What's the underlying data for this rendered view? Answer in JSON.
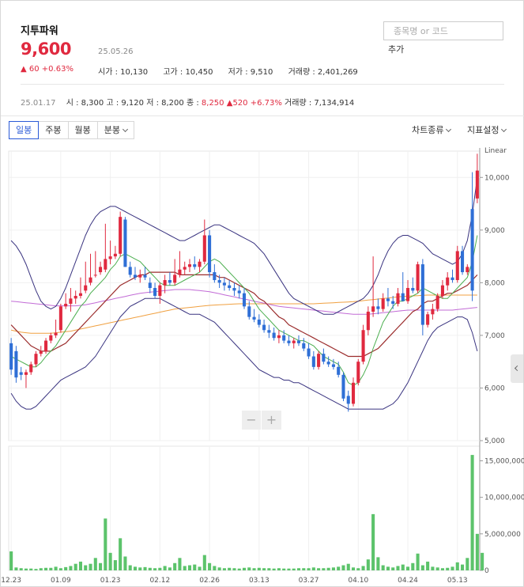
{
  "stock": {
    "name": "지투파워",
    "price": "9,600",
    "date": "25.05.26",
    "change": "60 +0.63%",
    "open": "시가 : 10,130",
    "high": "고가 : 10,450",
    "low": "저가 : 9,510",
    "volume": "거래량 : 2,401,269"
  },
  "search": {
    "placeholder": "종목명 or 코드",
    "add_label": "추가"
  },
  "base_info": {
    "date": "25.01.17",
    "open": "시 : 8,300",
    "high": "고 : 9,120",
    "low": "저 : 8,200",
    "close_label": "종 : ",
    "close_value": "8,250",
    "change": "520 +6.73%",
    "volume": "거래량 : 7,134,914"
  },
  "toolbar": {
    "tabs": [
      "일봉",
      "주봉",
      "월봉",
      "분봉"
    ],
    "chart_type": "차트종류",
    "indicator": "지표설정"
  },
  "zoom": {
    "minus": "−",
    "plus": "+"
  },
  "colors": {
    "up": "#e0293f",
    "down": "#2f6fd6",
    "volume": "#5cc36b",
    "bollinger": "#3a3480",
    "ma5": "#4caf50",
    "ma20": "#9b2c2c",
    "ma60": "#c26bd6",
    "ma120": "#f0a040"
  },
  "chart_data": [
    {
      "type": "candlestick",
      "scale_label": "Linear",
      "ylim": [
        5000,
        10500
      ],
      "yticks": [
        5000,
        6000,
        7000,
        8000,
        9000,
        10000
      ],
      "ytick_labels": [
        "5,000",
        "6,000",
        "7,000",
        "8,000",
        "9,000",
        "10,000"
      ],
      "x_labels": [
        "12.23",
        "01.09",
        "01.23",
        "02.12",
        "02.26",
        "03.13",
        "03.27",
        "04.10",
        "04.24",
        "05.13"
      ],
      "x_label_index": [
        0,
        10,
        20,
        30,
        40,
        50,
        60,
        70,
        80,
        90
      ],
      "ohlc": [
        [
          6850,
          6950,
          6250,
          6350
        ],
        [
          6700,
          6800,
          6100,
          6200
        ],
        [
          6300,
          6400,
          6150,
          6250
        ],
        [
          6250,
          6350,
          6000,
          6300
        ],
        [
          6300,
          6500,
          6250,
          6450
        ],
        [
          6450,
          6700,
          6400,
          6650
        ],
        [
          6650,
          6800,
          6600,
          6700
        ],
        [
          6700,
          6950,
          6650,
          6900
        ],
        [
          6900,
          7050,
          6850,
          7000
        ],
        [
          7000,
          7300,
          6950,
          7050
        ],
        [
          7100,
          7600,
          7050,
          7550
        ],
        [
          7550,
          7800,
          7500,
          7600
        ],
        [
          7600,
          7900,
          7450,
          7700
        ],
        [
          7700,
          7850,
          7600,
          7750
        ],
        [
          7750,
          8100,
          7700,
          7800
        ],
        [
          7850,
          8400,
          7800,
          7950
        ],
        [
          8000,
          8550,
          7950,
          8100
        ],
        [
          8150,
          8600,
          8100,
          8150
        ],
        [
          8200,
          8400,
          8150,
          8300
        ],
        [
          8250,
          9120,
          8200,
          8450
        ],
        [
          8450,
          8800,
          8350,
          8500
        ],
        [
          8500,
          8700,
          8450,
          8550
        ],
        [
          8550,
          9350,
          8500,
          9250
        ],
        [
          9200,
          9250,
          8300,
          8300
        ],
        [
          8300,
          8400,
          8100,
          8150
        ],
        [
          8150,
          8300,
          8050,
          8100
        ],
        [
          8100,
          8250,
          8000,
          8150
        ],
        [
          8150,
          8300,
          8050,
          8100
        ],
        [
          8000,
          8100,
          7800,
          7900
        ],
        [
          7900,
          8000,
          7700,
          7750
        ],
        [
          7750,
          8000,
          7600,
          7950
        ],
        [
          7950,
          8150,
          7800,
          8050
        ],
        [
          8050,
          8200,
          7950,
          8000
        ],
        [
          8000,
          8450,
          7950,
          8150
        ],
        [
          8150,
          8600,
          8100,
          8250
        ],
        [
          8250,
          8400,
          8150,
          8300
        ],
        [
          8300,
          8450,
          8200,
          8350
        ],
        [
          8350,
          8500,
          8250,
          8300
        ],
        [
          8300,
          8450,
          8200,
          8400
        ],
        [
          8400,
          9200,
          8350,
          8900
        ],
        [
          8900,
          9000,
          8100,
          8200
        ],
        [
          8200,
          8350,
          8000,
          8050
        ],
        [
          8050,
          8150,
          7900,
          8000
        ],
        [
          8000,
          8100,
          7850,
          7950
        ],
        [
          7950,
          8050,
          7850,
          7900
        ],
        [
          7900,
          8000,
          7750,
          7850
        ],
        [
          7850,
          7950,
          7700,
          7800
        ],
        [
          7800,
          7900,
          7500,
          7550
        ],
        [
          7550,
          7650,
          7300,
          7350
        ],
        [
          7350,
          7500,
          7250,
          7300
        ],
        [
          7300,
          7400,
          7150,
          7200
        ],
        [
          7200,
          7300,
          7050,
          7100
        ],
        [
          7100,
          7200,
          6950,
          7050
        ],
        [
          7050,
          7150,
          6900,
          6950
        ],
        [
          6950,
          7100,
          6850,
          7000
        ],
        [
          7000,
          7100,
          6850,
          6900
        ],
        [
          6900,
          7000,
          6800,
          6850
        ],
        [
          6850,
          6950,
          6750,
          6900
        ],
        [
          6900,
          7000,
          6800,
          6850
        ],
        [
          6850,
          6950,
          6700,
          6750
        ],
        [
          6750,
          6850,
          6550,
          6600
        ],
        [
          6600,
          6700,
          6350,
          6400
        ],
        [
          6400,
          6700,
          6350,
          6650
        ],
        [
          6650,
          6750,
          6450,
          6500
        ],
        [
          6500,
          6600,
          6400,
          6450
        ],
        [
          6450,
          6550,
          6350,
          6400
        ],
        [
          6400,
          6500,
          6200,
          6250
        ],
        [
          6250,
          6300,
          5750,
          5800
        ],
        [
          5850,
          5950,
          5550,
          5700
        ],
        [
          5700,
          6200,
          5650,
          6100
        ],
        [
          6100,
          6550,
          6050,
          6500
        ],
        [
          6500,
          7200,
          6450,
          7100
        ],
        [
          7100,
          7550,
          7000,
          7450
        ],
        [
          7450,
          8500,
          7350,
          7550
        ],
        [
          7550,
          7700,
          7400,
          7500
        ],
        [
          7500,
          7800,
          7450,
          7700
        ],
        [
          7700,
          7900,
          7550,
          7650
        ],
        [
          7650,
          7750,
          7500,
          7600
        ],
        [
          7600,
          7900,
          7550,
          7800
        ],
        [
          7800,
          8200,
          7700,
          7650
        ],
        [
          7650,
          8050,
          7600,
          7900
        ],
        [
          7900,
          8100,
          7800,
          7850
        ],
        [
          7850,
          8400,
          7800,
          8350
        ],
        [
          8350,
          8450,
          7000,
          7200
        ],
        [
          7200,
          7450,
          7150,
          7400
        ],
        [
          7400,
          7600,
          7300,
          7500
        ],
        [
          7500,
          7800,
          7450,
          7750
        ],
        [
          7750,
          8050,
          7700,
          7950
        ],
        [
          7950,
          8200,
          7850,
          8100
        ],
        [
          8100,
          8250,
          8000,
          8050
        ],
        [
          8050,
          8700,
          8000,
          8600
        ],
        [
          8600,
          8700,
          8150,
          8200
        ],
        [
          8200,
          8350,
          8150,
          8300
        ],
        [
          9400,
          10100,
          7650,
          7850
        ],
        [
          9600,
          10450,
          9510,
          10130
        ]
      ],
      "ma5": [
        6600,
        6550,
        6500,
        6450,
        6400,
        6400,
        6480,
        6600,
        6700,
        6800,
        6950,
        7100,
        7250,
        7400,
        7550,
        7650,
        7800,
        7900,
        8000,
        8100,
        8250,
        8350,
        8500,
        8550,
        8500,
        8450,
        8400,
        8300,
        8200,
        8100,
        8000,
        7950,
        7950,
        7950,
        8000,
        8050,
        8100,
        8150,
        8200,
        8300,
        8400,
        8450,
        8400,
        8300,
        8200,
        8100,
        8000,
        7900,
        7800,
        7650,
        7500,
        7400,
        7300,
        7200,
        7100,
        7050,
        7000,
        6950,
        6900,
        6900,
        6850,
        6800,
        6700,
        6600,
        6550,
        6500,
        6450,
        6300,
        6100,
        6050,
        6100,
        6250,
        6450,
        6750,
        7000,
        7250,
        7400,
        7550,
        7650,
        7650,
        7700,
        7750,
        7800,
        7900,
        7850,
        7800,
        7750,
        7700,
        7700,
        7800,
        7900,
        8000,
        8100,
        8400,
        8900
      ],
      "ma20": [
        7200,
        7100,
        7000,
        6900,
        6800,
        6750,
        6700,
        6700,
        6700,
        6750,
        6800,
        6850,
        6950,
        7050,
        7150,
        7250,
        7350,
        7450,
        7550,
        7650,
        7750,
        7850,
        7950,
        8000,
        8050,
        8100,
        8150,
        8150,
        8200,
        8200,
        8200,
        8200,
        8200,
        8200,
        8150,
        8150,
        8150,
        8150,
        8150,
        8150,
        8150,
        8150,
        8100,
        8100,
        8050,
        8000,
        7950,
        7900,
        7850,
        7800,
        7700,
        7650,
        7550,
        7450,
        7350,
        7300,
        7200,
        7150,
        7100,
        7050,
        7000,
        6950,
        6900,
        6850,
        6800,
        6750,
        6700,
        6650,
        6600,
        6600,
        6600,
        6600,
        6650,
        6700,
        6750,
        6850,
        6950,
        7050,
        7150,
        7250,
        7350,
        7450,
        7500,
        7600,
        7650,
        7650,
        7700,
        7750,
        7800,
        7800,
        7850,
        7900,
        7950,
        8050,
        8150
      ],
      "ma60": [
        7650,
        7640,
        7630,
        7620,
        7610,
        7600,
        7590,
        7580,
        7570,
        7560,
        7560,
        7560,
        7560,
        7560,
        7570,
        7580,
        7600,
        7620,
        7640,
        7660,
        7680,
        7700,
        7720,
        7740,
        7760,
        7780,
        7800,
        7810,
        7820,
        7830,
        7840,
        7850,
        7860,
        7870,
        7870,
        7870,
        7870,
        7860,
        7850,
        7840,
        7830,
        7810,
        7790,
        7770,
        7750,
        7730,
        7710,
        7690,
        7670,
        7650,
        7630,
        7610,
        7590,
        7570,
        7550,
        7540,
        7530,
        7520,
        7510,
        7500,
        7490,
        7480,
        7470,
        7460,
        7450,
        7440,
        7430,
        7420,
        7410,
        7400,
        7400,
        7400,
        7400,
        7410,
        7420,
        7430,
        7440,
        7450,
        7460,
        7470,
        7480,
        7480,
        7480,
        7480,
        7480,
        7480,
        7480,
        7480,
        7480,
        7480,
        7490,
        7500,
        7510,
        7520,
        7530
      ],
      "ma120": [
        7100,
        7080,
        7060,
        7050,
        7040,
        7040,
        7040,
        7040,
        7040,
        7050,
        7060,
        7070,
        7080,
        7100,
        7120,
        7140,
        7160,
        7180,
        7200,
        7220,
        7240,
        7260,
        7280,
        7300,
        7320,
        7340,
        7360,
        7380,
        7400,
        7420,
        7440,
        7460,
        7480,
        7500,
        7510,
        7520,
        7530,
        7540,
        7550,
        7560,
        7570,
        7575,
        7580,
        7585,
        7590,
        7595,
        7600,
        7600,
        7600,
        7600,
        7600,
        7600,
        7600,
        7600,
        7600,
        7600,
        7600,
        7600,
        7600,
        7600,
        7600,
        7600,
        7605,
        7610,
        7615,
        7620,
        7625,
        7630,
        7635,
        7640,
        7650,
        7660,
        7670,
        7680,
        7690,
        7700,
        7710,
        7720,
        7730,
        7740,
        7745,
        7750,
        7755,
        7760,
        7765,
        7765,
        7765,
        7765,
        7765,
        7765,
        7765,
        7765,
        7765,
        7765,
        7765
      ],
      "bb_upper": [
        8800,
        8700,
        8550,
        8350,
        8100,
        7850,
        7650,
        7550,
        7500,
        7550,
        7700,
        7900,
        8150,
        8400,
        8650,
        8900,
        9100,
        9250,
        9350,
        9400,
        9450,
        9450,
        9400,
        9350,
        9300,
        9250,
        9200,
        9150,
        9100,
        9050,
        9000,
        8950,
        8900,
        8850,
        8800,
        8800,
        8850,
        8900,
        8950,
        9000,
        9050,
        9100,
        9100,
        9050,
        9000,
        8950,
        8900,
        8850,
        8800,
        8750,
        8650,
        8550,
        8400,
        8250,
        8100,
        7950,
        7800,
        7700,
        7650,
        7600,
        7550,
        7500,
        7450,
        7400,
        7400,
        7400,
        7450,
        7500,
        7550,
        7600,
        7650,
        7700,
        7800,
        7950,
        8150,
        8400,
        8600,
        8750,
        8850,
        8900,
        8900,
        8850,
        8800,
        8750,
        8650,
        8550,
        8500,
        8450,
        8400,
        8350,
        8400,
        8550,
        8800,
        9300,
        10000
      ],
      "bb_lower": [
        5900,
        5750,
        5650,
        5600,
        5600,
        5650,
        5750,
        5850,
        5950,
        6050,
        6150,
        6200,
        6250,
        6300,
        6350,
        6400,
        6500,
        6600,
        6750,
        6900,
        7050,
        7200,
        7350,
        7450,
        7550,
        7600,
        7650,
        7700,
        7700,
        7700,
        7700,
        7650,
        7600,
        7550,
        7500,
        7450,
        7400,
        7400,
        7400,
        7350,
        7300,
        7250,
        7150,
        7050,
        6950,
        6850,
        6750,
        6650,
        6550,
        6450,
        6350,
        6300,
        6250,
        6200,
        6200,
        6150,
        6150,
        6100,
        6100,
        6050,
        6000,
        5950,
        5900,
        5850,
        5800,
        5750,
        5700,
        5650,
        5600,
        5600,
        5600,
        5600,
        5600,
        5600,
        5600,
        5600,
        5650,
        5700,
        5800,
        5950,
        6100,
        6300,
        6500,
        6700,
        6900,
        7050,
        7150,
        7200,
        7250,
        7300,
        7350,
        7350,
        7300,
        7050,
        6700
      ]
    },
    {
      "type": "bar",
      "series_name": "거래량",
      "ylim": [
        0,
        17000000
      ],
      "yticks": [
        0,
        5000000,
        10000000,
        15000000
      ],
      "ytick_labels": [
        "0",
        "5,000,000",
        "10,000,000",
        "15,000,000"
      ],
      "volume": [
        2600000,
        400000,
        300000,
        250000,
        250000,
        200000,
        300000,
        350000,
        350000,
        500000,
        300000,
        450000,
        600000,
        900000,
        1200000,
        700000,
        900000,
        1700000,
        1000000,
        7100000,
        2400000,
        1400000,
        4400000,
        1900000,
        700000,
        500000,
        400000,
        450000,
        350000,
        300000,
        350000,
        600000,
        400000,
        1000000,
        1700000,
        600000,
        700000,
        800000,
        500000,
        2100000,
        1000000,
        600000,
        400000,
        300000,
        350000,
        300000,
        250000,
        350000,
        400000,
        300000,
        350000,
        300000,
        300000,
        250000,
        300000,
        250000,
        250000,
        250000,
        300000,
        300000,
        300000,
        400000,
        300000,
        300000,
        350000,
        400000,
        500000,
        700000,
        900000,
        400000,
        300000,
        600000,
        1500000,
        7700000,
        1800000,
        700000,
        500000,
        400000,
        600000,
        800000,
        500000,
        1000000,
        2300000,
        700000,
        1200000,
        500000,
        400000,
        300000,
        350000,
        500000,
        1100000,
        800000,
        1700000,
        15800000,
        5000000,
        2400000
      ]
    }
  ]
}
